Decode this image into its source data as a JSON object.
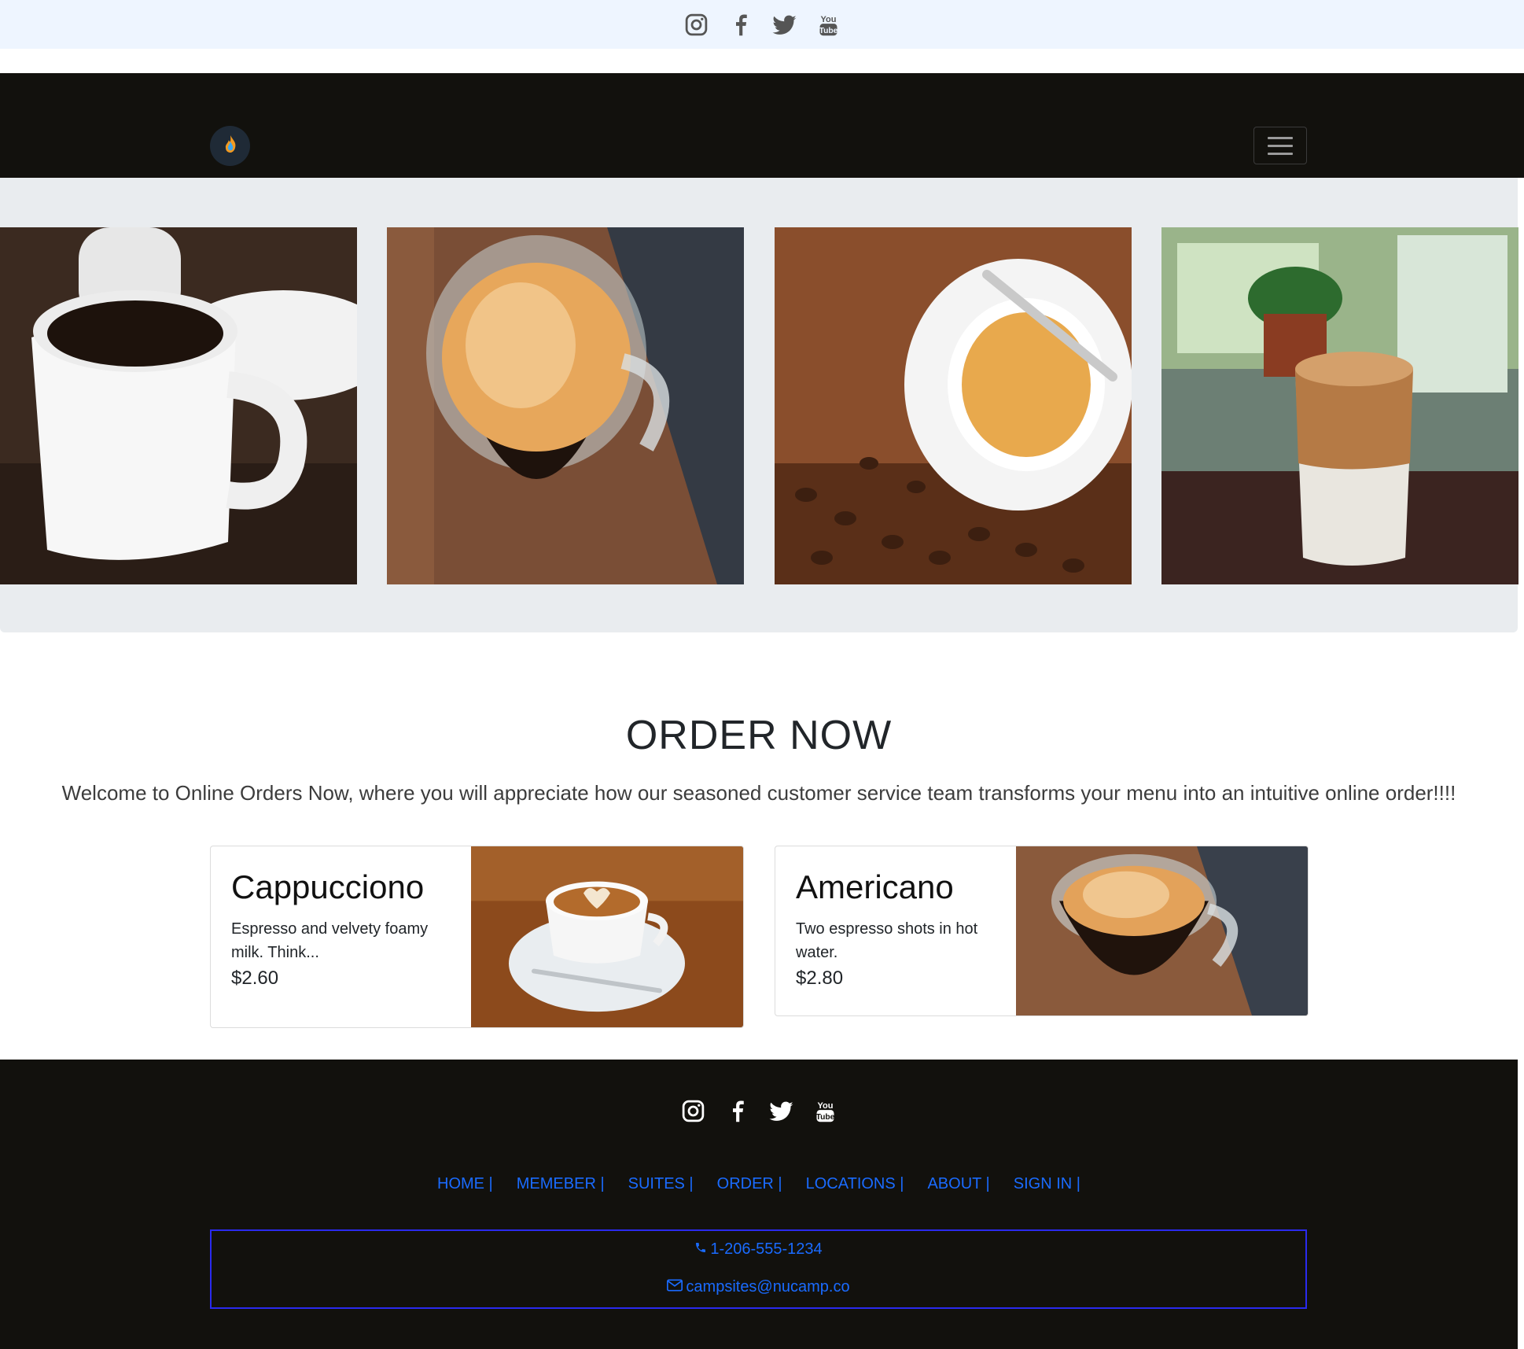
{
  "social_icons": [
    "instagram-icon",
    "facebook-icon",
    "twitter-icon",
    "youtube-icon"
  ],
  "colors": {
    "navbar_bg": "#12110d",
    "top_bar_bg": "#eef5ff",
    "jumbotron_bg": "#e9ecef",
    "link": "#1a6bff",
    "contact_border": "#2a2aee"
  },
  "navbar": {
    "brand_icon": "flame-logo-icon",
    "toggler_icon": "hamburger-menu-icon"
  },
  "carousel": {
    "slides": [
      "coffee-mug-image",
      "espresso-glass-image",
      "coffee-cup-beans-image",
      "iced-latte-image"
    ]
  },
  "order": {
    "title": "ORDER NOW",
    "lead": "Welcome to Online Orders Now, where you will appreciate how our seasoned customer service team transforms your menu into an intuitive online order!!!!"
  },
  "products": [
    {
      "name": "Cappucciono",
      "description": "Espresso and velvety foamy milk. Think...",
      "price": "$2.60"
    },
    {
      "name": "Americano",
      "description": "Two espresso shots in hot water.",
      "price": "$2.80"
    }
  ],
  "footer": {
    "links": [
      "HOME |",
      "MEMEBER |",
      "SUITES |",
      "ORDER |",
      "LOCATIONS |",
      "ABOUT |",
      "SIGN IN |"
    ],
    "phone": "1-206-555-1234",
    "email": "campsites@nucamp.co",
    "phone_icon": "phone-icon",
    "email_icon": "envelope-icon"
  }
}
